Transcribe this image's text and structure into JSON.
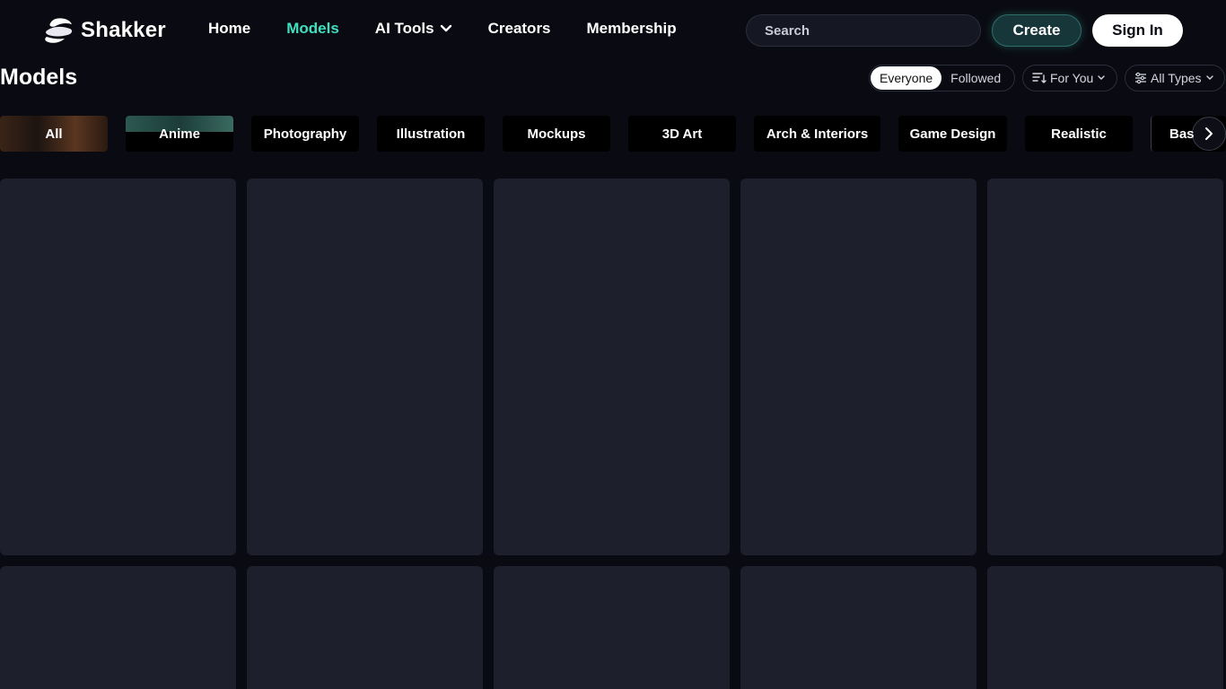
{
  "brand": {
    "name": "Shakker"
  },
  "nav": {
    "home": "Home",
    "models": "Models",
    "ai_tools": "AI Tools",
    "creators": "Creators",
    "membership": "Membership"
  },
  "search": {
    "placeholder": "Search"
  },
  "header_actions": {
    "create": "Create",
    "sign_in": "Sign In"
  },
  "page": {
    "title": "Models"
  },
  "audience": {
    "everyone": "Everyone",
    "followed": "Followed",
    "selected": "Everyone"
  },
  "filters": {
    "sort": "For You",
    "types": "All Types"
  },
  "categories": [
    "All",
    "Anime",
    "Photography",
    "Illustration",
    "Mockups",
    "3D Art",
    "Arch & Interiors",
    "Game Design",
    "Realistic",
    "Bas"
  ],
  "colors": {
    "accent": "#3ee0c0",
    "background": "#0a0b12",
    "card": "#1e1f2c"
  },
  "icons": {
    "logo": "shakker-logo-icon",
    "ai_tools_caret": "chevron-down-icon",
    "sort": "sort-icon",
    "types": "sliders-icon",
    "next": "chevron-right-icon"
  }
}
